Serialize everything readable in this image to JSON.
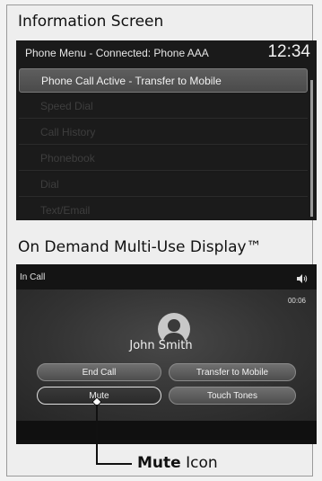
{
  "headings": {
    "info_screen": "Information Screen",
    "mid_display": "On Demand Multi-Use Display™"
  },
  "info_screen": {
    "header_title": "Phone Menu - Connected: Phone AAA",
    "clock": "12:34",
    "menu_items": [
      {
        "label": "Phone Call Active - Transfer to Mobile",
        "active": true
      },
      {
        "label": "Speed Dial",
        "active": false
      },
      {
        "label": "Call History",
        "active": false
      },
      {
        "label": "Phonebook",
        "active": false
      },
      {
        "label": "Dial",
        "active": false
      },
      {
        "label": "Text/Email",
        "active": false
      }
    ]
  },
  "mid_display": {
    "title": "In Call",
    "status_icon": "speaker-icon",
    "timer": "00:06",
    "contact_name": "John Smith",
    "buttons": {
      "end_call": "End Call",
      "transfer": "Transfer to Mobile",
      "mute": "Mute",
      "touch_tones": "Touch Tones"
    }
  },
  "callout": {
    "bold": "Mute",
    "rest": " Icon"
  }
}
